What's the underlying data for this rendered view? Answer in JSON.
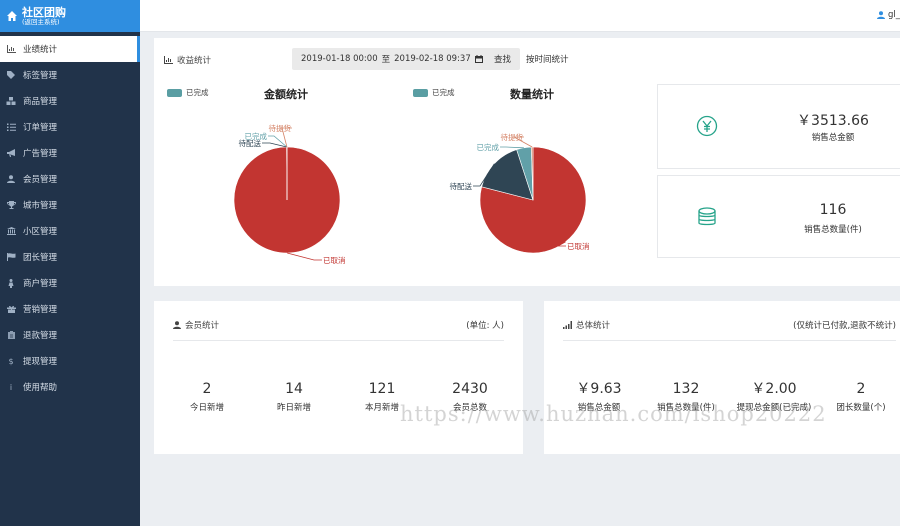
{
  "app": {
    "title": "社区团购",
    "subtitle": "(返回主系统)"
  },
  "topbar": {
    "user": "gl_"
  },
  "sidebar": {
    "items": [
      {
        "label": "业绩统计",
        "icon": "bar-chart-icon",
        "active": true
      },
      {
        "label": "标签管理",
        "icon": "tags-icon"
      },
      {
        "label": "商品管理",
        "icon": "cubes-icon"
      },
      {
        "label": "订单管理",
        "icon": "list-icon"
      },
      {
        "label": "广告管理",
        "icon": "bullhorn-icon"
      },
      {
        "label": "会员管理",
        "icon": "user-icon"
      },
      {
        "label": "城市管理",
        "icon": "trophy-icon"
      },
      {
        "label": "小区管理",
        "icon": "building-icon"
      },
      {
        "label": "团长管理",
        "icon": "flag-icon"
      },
      {
        "label": "商户管理",
        "icon": "merchant-icon"
      },
      {
        "label": "营销管理",
        "icon": "gift-icon"
      },
      {
        "label": "退款管理",
        "icon": "refund-icon"
      },
      {
        "label": "提现管理",
        "icon": "dollar-icon"
      },
      {
        "label": "使用帮助",
        "icon": "info-icon"
      }
    ]
  },
  "revenue": {
    "label": "收益统计",
    "date_start": "2019-01-18 00:00",
    "date_sep": "至",
    "date_end": "2019-02-18 09:37",
    "query_label": "查找",
    "time_stat_label": "按时间统计"
  },
  "chart_data": [
    {
      "type": "pie",
      "title": "金额统计",
      "legend": [
        "已完成"
      ],
      "slices": [
        {
          "label": "已取消",
          "value": 99.9,
          "color": "#c23531"
        },
        {
          "label": "待配送",
          "value": 0.04,
          "color": "#2f4554"
        },
        {
          "label": "已完成",
          "value": 0.03,
          "color": "#61a0a8"
        },
        {
          "label": "待提货",
          "value": 0.03,
          "color": "#d48265"
        }
      ]
    },
    {
      "type": "pie",
      "title": "数量统计",
      "legend": [
        "已完成"
      ],
      "slices": [
        {
          "label": "已取消",
          "value": 79,
          "color": "#c23531"
        },
        {
          "label": "待配送",
          "value": 16,
          "color": "#2f4554"
        },
        {
          "label": "已完成",
          "value": 4.5,
          "color": "#61a0a8"
        },
        {
          "label": "待提货",
          "value": 0.5,
          "color": "#d48265"
        }
      ]
    }
  ],
  "totals": {
    "amount_value": "￥3513.66",
    "amount_label": "销售总金额",
    "qty_value": "116",
    "qty_label": "销售总数量(件)"
  },
  "members": {
    "title": "会员统计",
    "unit": "(单位: 人)",
    "stats": [
      {
        "value": "2",
        "label": "今日新增"
      },
      {
        "value": "14",
        "label": "昨日新增"
      },
      {
        "value": "121",
        "label": "本月新增"
      },
      {
        "value": "2430",
        "label": "会员总数"
      }
    ]
  },
  "overall": {
    "title": "总体统计",
    "note": "(仅统计已付款,退款不统计)",
    "stats": [
      {
        "value": "￥9.63",
        "label": "销售总金额"
      },
      {
        "value": "132",
        "label": "销售总数量(件)"
      },
      {
        "value": "￥2.00",
        "label": "提现总金额(已完成)"
      },
      {
        "value": "2",
        "label": "团长数量(个)"
      }
    ]
  },
  "watermark": "https://www.huzhan.com/ishop20222"
}
